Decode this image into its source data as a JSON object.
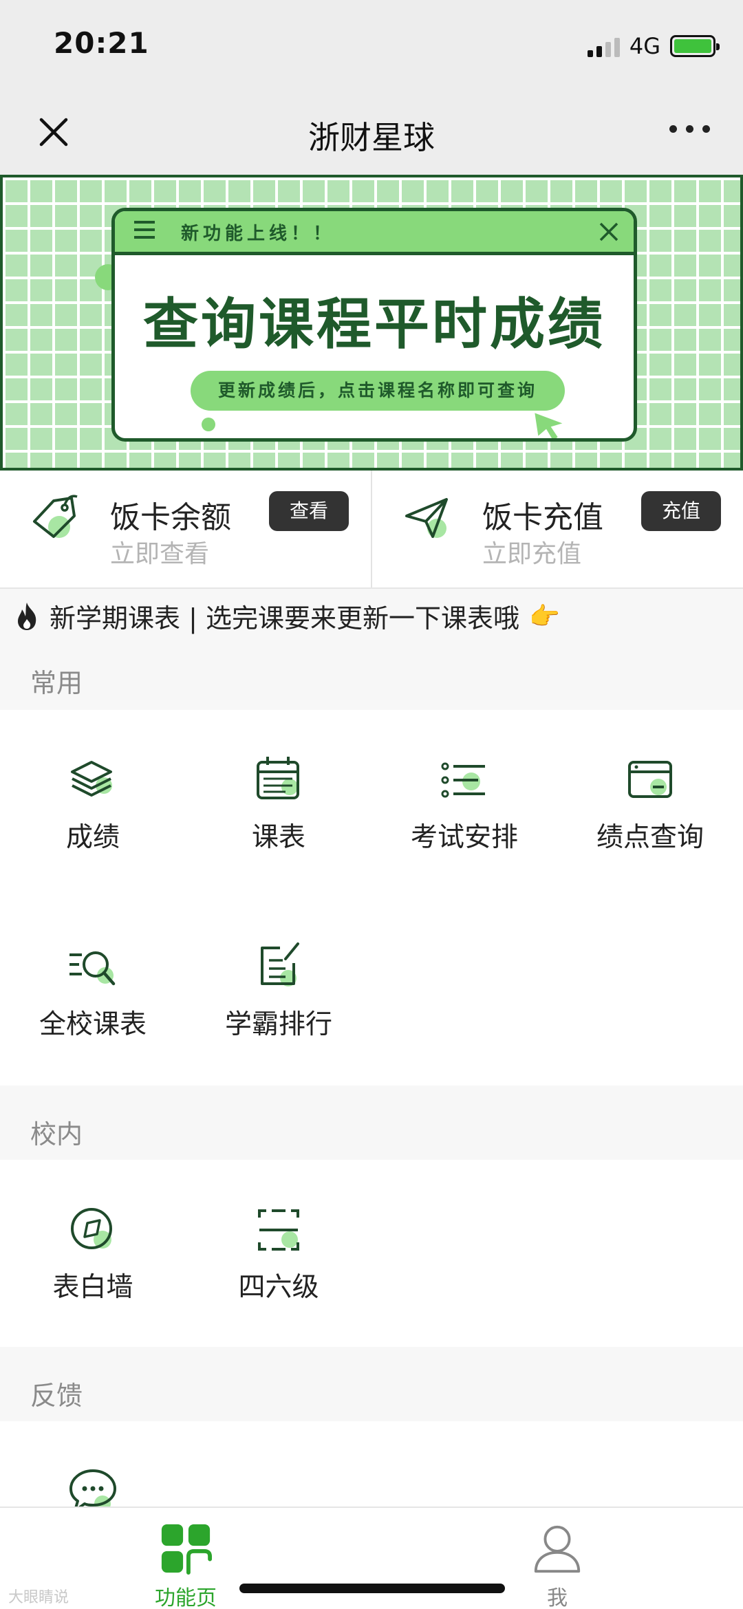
{
  "status_bar": {
    "time": "20:21",
    "network": "4G"
  },
  "nav": {
    "title": "浙财星球"
  },
  "banner": {
    "tag": "新功能上线！！",
    "headline": "查询课程平时成绩",
    "pill_text": "更新成绩后，点击课程名称即可查询"
  },
  "cards": [
    {
      "title": "饭卡余额",
      "subtitle": "立即查看",
      "button": "查看",
      "icon": "price-tag-icon"
    },
    {
      "title": "饭卡充值",
      "subtitle": "立即充值",
      "button": "充值",
      "icon": "paper-plane-icon"
    }
  ],
  "notice": {
    "text": "新学期课表 | 选完课要来更新一下课表哦",
    "emoji": "👉"
  },
  "sections": {
    "common": {
      "label": "常用",
      "items": [
        {
          "label": "成绩",
          "icon": "layers-icon"
        },
        {
          "label": "课表",
          "icon": "calendar-icon"
        },
        {
          "label": "考试安排",
          "icon": "list-icon"
        },
        {
          "label": "绩点查询",
          "icon": "card-icon"
        },
        {
          "label": "全校课表",
          "icon": "search-list-icon"
        },
        {
          "label": "学霸排行",
          "icon": "edit-note-icon"
        }
      ]
    },
    "campus": {
      "label": "校内",
      "items": [
        {
          "label": "表白墙",
          "icon": "compass-icon"
        },
        {
          "label": "四六级",
          "icon": "scan-icon"
        }
      ]
    },
    "feedback": {
      "label": "反馈",
      "items": [
        {
          "label": "",
          "icon": "chat-icon"
        }
      ]
    }
  },
  "tab_bar": {
    "tabs": [
      {
        "label": "功能页",
        "active": true,
        "icon": "grid-icon"
      },
      {
        "label": "我",
        "active": false,
        "icon": "user-icon"
      }
    ],
    "active_color": "#2ca52c"
  },
  "watermark": "大眼睛说"
}
